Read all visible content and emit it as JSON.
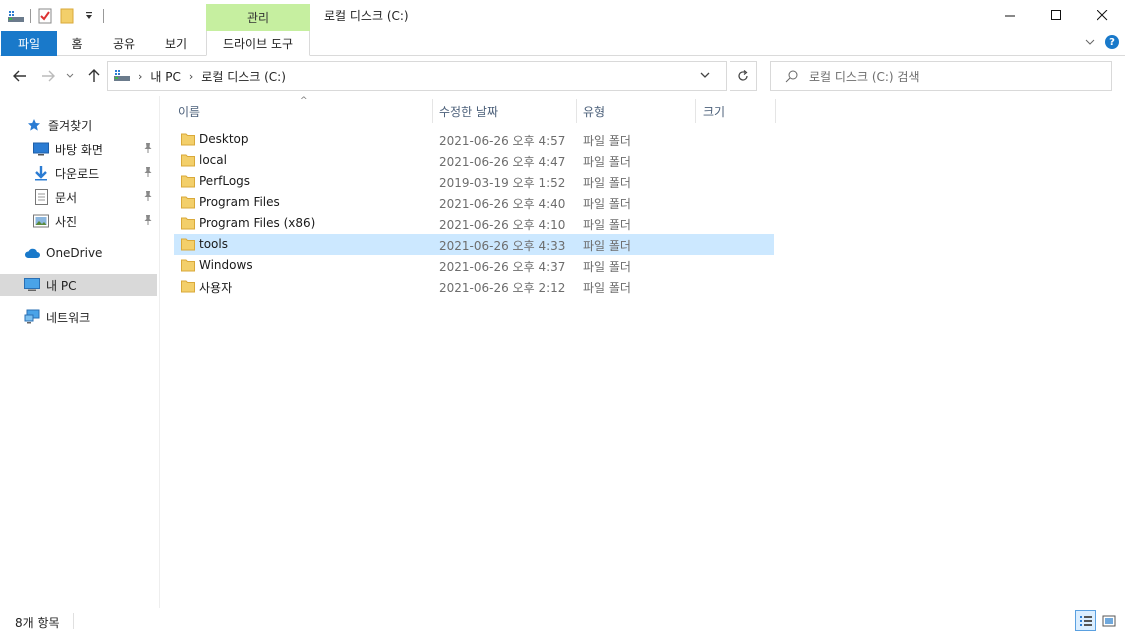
{
  "window": {
    "title": "로컬 디스크 (C:)",
    "context_tab_group": "관리"
  },
  "ribbon": {
    "tabs": [
      {
        "label": "파일"
      },
      {
        "label": "홈"
      },
      {
        "label": "공유"
      },
      {
        "label": "보기"
      },
      {
        "label": "드라이브 도구"
      }
    ],
    "help_label": "?"
  },
  "address": {
    "breadcrumbs": [
      "내 PC",
      "로컬 디스크 (C:)"
    ],
    "search_placeholder": "로컬 디스크 (C:) 검색"
  },
  "nav_pane": {
    "quick_access": "즐겨찾기",
    "quick_items": [
      {
        "label": "바탕 화면",
        "icon": "desktop-icon"
      },
      {
        "label": "다운로드",
        "icon": "download-icon"
      },
      {
        "label": "문서",
        "icon": "documents-icon"
      },
      {
        "label": "사진",
        "icon": "pictures-icon"
      }
    ],
    "onedrive": "OneDrive",
    "this_pc": "내 PC",
    "network": "네트워크"
  },
  "file_list": {
    "columns": [
      "이름",
      "수정한 날짜",
      "유형",
      "크기"
    ],
    "rows": [
      {
        "name": "Desktop",
        "date": "2021-06-26 오후 4:57",
        "type": "파일 폴더",
        "selected": false
      },
      {
        "name": "local",
        "date": "2021-06-26 오후 4:47",
        "type": "파일 폴더",
        "selected": false
      },
      {
        "name": "PerfLogs",
        "date": "2019-03-19 오후 1:52",
        "type": "파일 폴더",
        "selected": false
      },
      {
        "name": "Program Files",
        "date": "2021-06-26 오후 4:40",
        "type": "파일 폴더",
        "selected": false
      },
      {
        "name": "Program Files (x86)",
        "date": "2021-06-26 오후 4:10",
        "type": "파일 폴더",
        "selected": false
      },
      {
        "name": "tools",
        "date": "2021-06-26 오후 4:33",
        "type": "파일 폴더",
        "selected": true
      },
      {
        "name": "Windows",
        "date": "2021-06-26 오후 4:37",
        "type": "파일 폴더",
        "selected": false
      },
      {
        "name": "사용자",
        "date": "2021-06-26 오후 2:12",
        "type": "파일 폴더",
        "selected": false
      }
    ]
  },
  "status": {
    "item_count": "8개 항목"
  },
  "colors": {
    "accent": "#1979ca",
    "context_tab": "#c6efa0",
    "selection": "#cce8ff",
    "folder": "#f3cf6a"
  }
}
